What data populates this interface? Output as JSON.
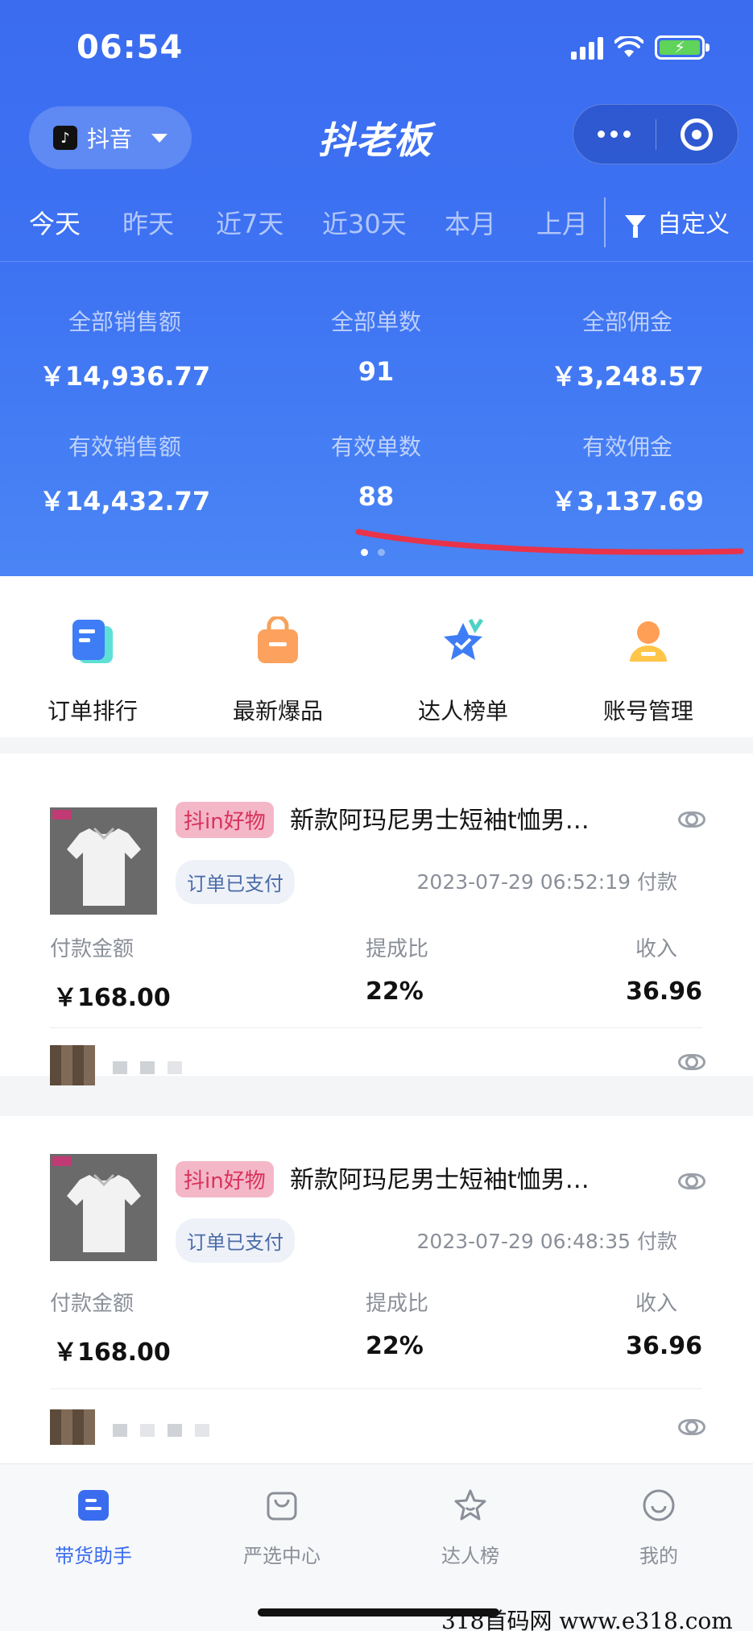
{
  "status_bar": {
    "time": "06:54"
  },
  "header": {
    "platform": "抖音",
    "brand": "抖老板"
  },
  "tabs": [
    "今天",
    "昨天",
    "近7天",
    "近30天",
    "本月",
    "上月"
  ],
  "custom_label": "自定义",
  "stats": [
    {
      "label": "全部销售额",
      "value": "￥14,936.77"
    },
    {
      "label": "全部单数",
      "value": "91"
    },
    {
      "label": "全部佣金",
      "value": "￥3,248.57"
    },
    {
      "label": "有效销售额",
      "value": "￥14,432.77"
    },
    {
      "label": "有效单数",
      "value": "88"
    },
    {
      "label": "有效佣金",
      "value": "￥3,137.69"
    }
  ],
  "quick_menu": [
    {
      "label": "订单排行",
      "icon": "order-rank-icon"
    },
    {
      "label": "最新爆品",
      "icon": "shopping-bag-icon"
    },
    {
      "label": "达人榜单",
      "icon": "star-check-icon"
    },
    {
      "label": "账号管理",
      "icon": "user-badge-icon"
    }
  ],
  "orders": [
    {
      "badge": "抖in好物",
      "title": "新款阿玛尼男士短袖t恤男…",
      "status": "订单已支付",
      "time": "2023-07-29 06:52:19 付款",
      "amount_label": "付款金额",
      "amount": "￥168.00",
      "rate_label": "提成比",
      "rate": "22%",
      "income_label": "收入",
      "income": "36.96"
    },
    {
      "badge": "抖in好物",
      "title": "新款阿玛尼男士短袖t恤男…",
      "status": "订单已支付",
      "time": "2023-07-29 06:48:35 付款",
      "amount_label": "付款金额",
      "amount": "￥168.00",
      "rate_label": "提成比",
      "rate": "22%",
      "income_label": "收入",
      "income": "36.96"
    }
  ],
  "bottom_nav": [
    {
      "label": "带货助手",
      "icon": "assistant-icon",
      "active": true
    },
    {
      "label": "严选中心",
      "icon": "bag-icon",
      "active": false
    },
    {
      "label": "达人榜",
      "icon": "star-icon",
      "active": false
    },
    {
      "label": "我的",
      "icon": "smile-icon",
      "active": false
    }
  ],
  "watermark": "318首码网 www.e318.com",
  "colors": {
    "primary": "#3b6cf0",
    "badge_bg": "#f4b7c7",
    "badge_text": "#d8325c",
    "red_stroke": "#e8334a"
  }
}
